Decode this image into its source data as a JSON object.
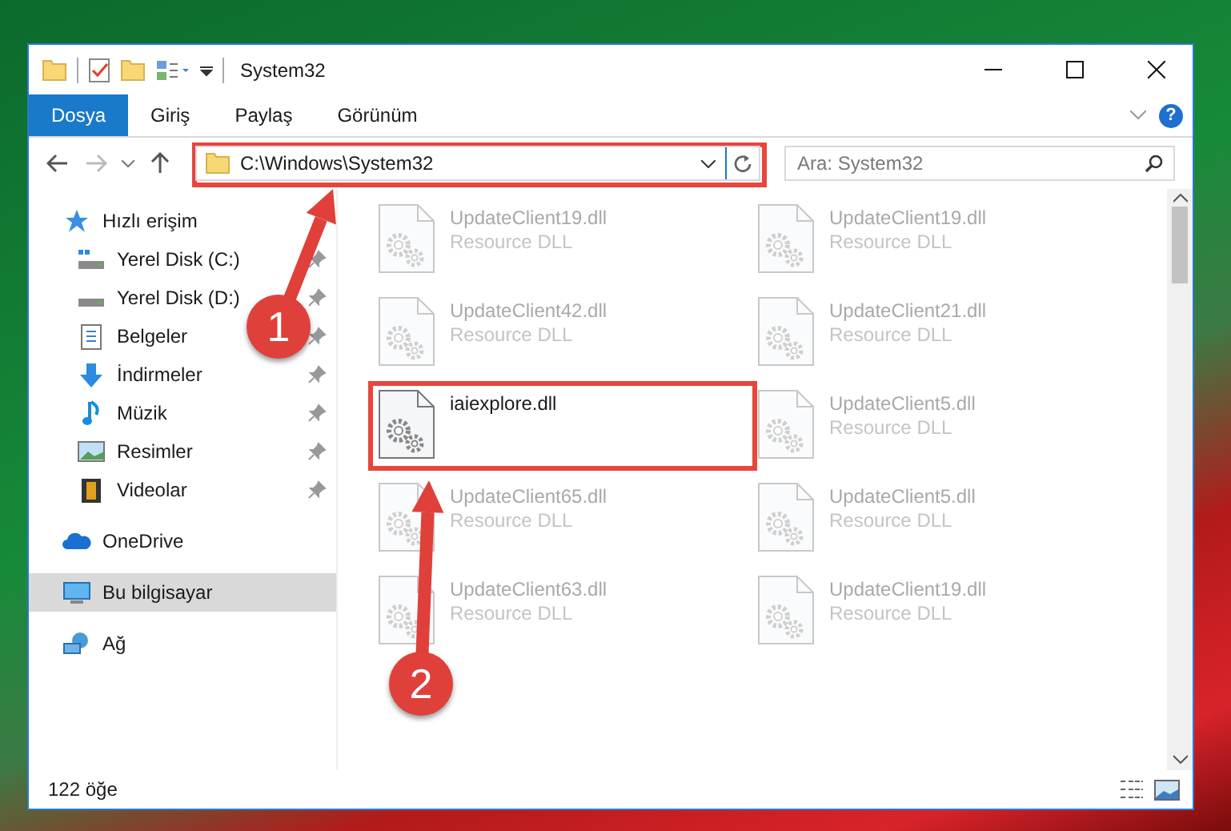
{
  "window": {
    "title": "System32"
  },
  "ribbon_tabs": [
    {
      "label": "Dosya",
      "kind": "file"
    },
    {
      "label": "Giriş",
      "kind": "tab"
    },
    {
      "label": "Paylaş",
      "kind": "tab"
    },
    {
      "label": "Görünüm",
      "kind": "tab"
    }
  ],
  "help_button": {
    "label": "?"
  },
  "address": {
    "value": "C:\\Windows\\System32"
  },
  "search": {
    "placeholder": "Ara: System32"
  },
  "sidebar": {
    "items": [
      {
        "label": "Hızlı erişim",
        "selected": false,
        "children": [
          {
            "label": "Yerel Disk (C:)",
            "selected": false,
            "pinned": true
          },
          {
            "label": "Yerel Disk (D:)",
            "selected": false,
            "pinned": true
          },
          {
            "label": "Belgeler",
            "selected": false,
            "pinned": true
          },
          {
            "label": "İndirmeler",
            "selected": false,
            "pinned": true
          },
          {
            "label": "Müzik",
            "selected": false,
            "pinned": true
          },
          {
            "label": "Resimler",
            "selected": false,
            "pinned": true
          },
          {
            "label": "Videolar",
            "selected": false,
            "pinned": true
          }
        ]
      },
      {
        "label": "OneDrive",
        "selected": false
      },
      {
        "label": "Bu bilgisayar",
        "selected": true
      },
      {
        "label": "Ağ",
        "selected": false
      }
    ]
  },
  "files": [
    {
      "name": "UpdateClient19.dll",
      "type": "Resource DLL",
      "dimmed": true
    },
    {
      "name": "UpdateClient19.dll",
      "type": "Resource DLL",
      "dimmed": true
    },
    {
      "name": "UpdateClient42.dll",
      "type": "Resource DLL",
      "dimmed": true
    },
    {
      "name": "UpdateClient21.dll",
      "type": "Resource DLL",
      "dimmed": true
    },
    {
      "name": "iaiexplore.dll",
      "dimmed": false
    },
    {
      "name": "UpdateClient5.dll",
      "type": "Resource DLL",
      "dimmed": true
    },
    {
      "name": "UpdateClient65.dll",
      "type": "Resource DLL",
      "dimmed": true
    },
    {
      "name": "UpdateClient5.dll",
      "type": "Resource DLL",
      "dimmed": true
    },
    {
      "name": "UpdateClient63.dll",
      "type": "Resource DLL",
      "dimmed": true
    },
    {
      "name": "UpdateClient19.dll",
      "type": "Resource DLL",
      "dimmed": true
    }
  ],
  "status_bar": {
    "item_count": "122 öğe"
  },
  "annotations": [
    {
      "number": "1"
    },
    {
      "number": "2"
    }
  ]
}
